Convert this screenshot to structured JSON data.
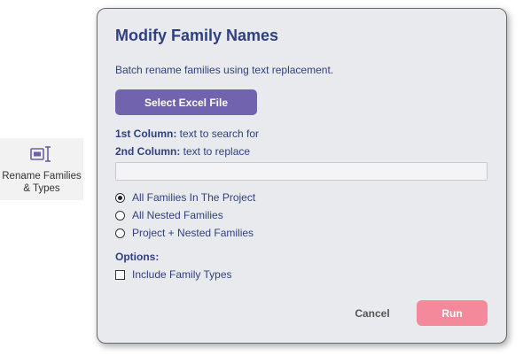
{
  "ribbon": {
    "button_label": "Rename Families\n& Types",
    "icon": "rename-icon"
  },
  "dialog": {
    "title": "Modify Family Names",
    "subtitle": "Batch rename families using text replacement.",
    "select_file_label": "Select Excel File",
    "column1_bold": "1st Column:",
    "column1_text": " text to search for",
    "column2_bold": "2nd Column:",
    "column2_text": " text to replace",
    "input_value": "",
    "scope_options": [
      {
        "label": "All Families In The Project",
        "selected": true
      },
      {
        "label": "All Nested Families",
        "selected": false
      },
      {
        "label": "Project + Nested Families",
        "selected": false
      }
    ],
    "options_label": "Options:",
    "include_types_label": "Include Family Types",
    "include_types_checked": false,
    "cancel_label": "Cancel",
    "run_label": "Run"
  },
  "colors": {
    "accent": "#7163ae",
    "title": "#2f3f7f",
    "run_button": "#f3899a"
  }
}
